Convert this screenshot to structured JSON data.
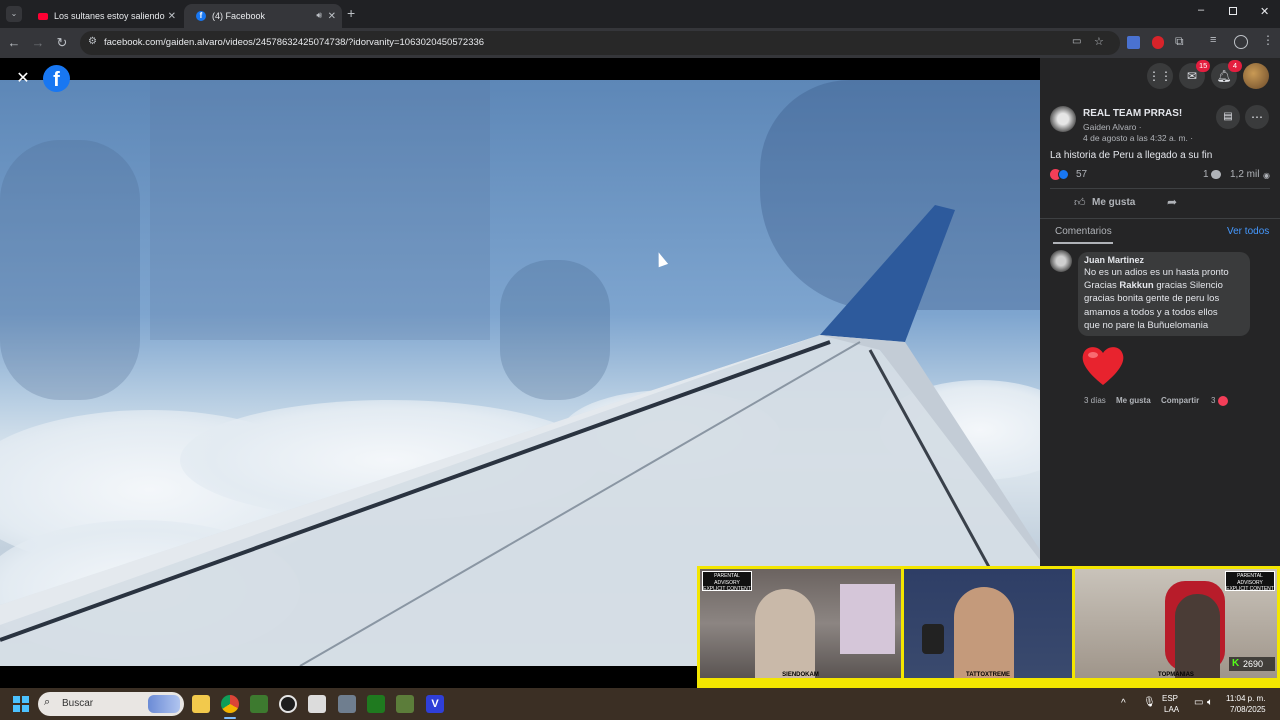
{
  "browser": {
    "tabs": [
      {
        "title": "Los sultanes estoy saliendo con",
        "active": false
      },
      {
        "title": "(4) Facebook",
        "active": true
      }
    ],
    "url": "facebook.com/gaiden.alvaro/videos/24578632425074738/?idorvanity=1063020450572336"
  },
  "fb_header": {
    "messenger_badge": "15",
    "notif_badge": "4"
  },
  "post": {
    "group": "REAL TEAM PRRAS!",
    "author": "Gaiden Alvaro ·",
    "date": "4 de agosto a las 4:32 a. m. ·",
    "caption": "La historia de Peru a llegado a su fin",
    "reactions": "57",
    "comments_count": "1",
    "views": "1,2 mil",
    "like_label": "Me gusta",
    "comments_tab": "Comentarios",
    "see_all": "Ver todos"
  },
  "comment": {
    "author": "Juan Martinez",
    "lines": [
      "No es un adios es un hasta pronto",
      "Gracias",
      "Rakkun",
      "gracias Silencio",
      "gracias bonita gente de peru los",
      "amamos a todos y a todos ellos",
      "que no pare la Buñuelomania"
    ],
    "time": "3 días",
    "like": "Me gusta",
    "share": "Compartir",
    "reaction_count": "3"
  },
  "cams": {
    "labels": [
      "SIENDOKAM",
      "TATTOXTREME",
      "TOPMANIAS"
    ],
    "viewer_count": "2690",
    "advisory": "PARENTAL ADVISORY EXPLICIT CONTENT"
  },
  "taskbar": {
    "search_placeholder": "Buscar",
    "lang_top": "ESP",
    "lang_bottom": "LAA",
    "time": "11:04 p. m.",
    "date": "7/08/2025"
  },
  "colors": {
    "fb_blue": "#1877f2",
    "panel_bg": "#252526",
    "cam_border": "#f3e600",
    "badge_red": "#e41e3f"
  }
}
